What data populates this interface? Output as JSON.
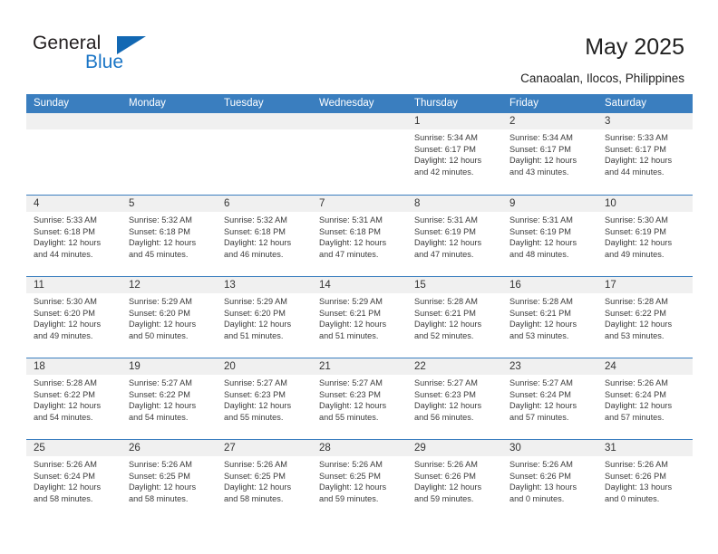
{
  "logo": {
    "word_top": "General",
    "word_bottom": "Blue",
    "triangle_color": "#1268b3",
    "blue_color": "#1a75c6"
  },
  "header": {
    "title": "May 2025",
    "subtitle": "Canaoalan, Ilocos, Philippines"
  },
  "calendar": {
    "header_color": "#3a7ebf",
    "weekdays": [
      "Sunday",
      "Monday",
      "Tuesday",
      "Wednesday",
      "Thursday",
      "Friday",
      "Saturday"
    ],
    "weeks": [
      [
        {
          "day": "",
          "empty": true
        },
        {
          "day": "",
          "empty": true
        },
        {
          "day": "",
          "empty": true
        },
        {
          "day": "",
          "empty": true
        },
        {
          "day": "1",
          "sunrise": "Sunrise: 5:34 AM",
          "sunset": "Sunset: 6:17 PM",
          "daylight": "Daylight: 12 hours and 42 minutes."
        },
        {
          "day": "2",
          "sunrise": "Sunrise: 5:34 AM",
          "sunset": "Sunset: 6:17 PM",
          "daylight": "Daylight: 12 hours and 43 minutes."
        },
        {
          "day": "3",
          "sunrise": "Sunrise: 5:33 AM",
          "sunset": "Sunset: 6:17 PM",
          "daylight": "Daylight: 12 hours and 44 minutes."
        }
      ],
      [
        {
          "day": "4",
          "sunrise": "Sunrise: 5:33 AM",
          "sunset": "Sunset: 6:18 PM",
          "daylight": "Daylight: 12 hours and 44 minutes."
        },
        {
          "day": "5",
          "sunrise": "Sunrise: 5:32 AM",
          "sunset": "Sunset: 6:18 PM",
          "daylight": "Daylight: 12 hours and 45 minutes."
        },
        {
          "day": "6",
          "sunrise": "Sunrise: 5:32 AM",
          "sunset": "Sunset: 6:18 PM",
          "daylight": "Daylight: 12 hours and 46 minutes."
        },
        {
          "day": "7",
          "sunrise": "Sunrise: 5:31 AM",
          "sunset": "Sunset: 6:18 PM",
          "daylight": "Daylight: 12 hours and 47 minutes."
        },
        {
          "day": "8",
          "sunrise": "Sunrise: 5:31 AM",
          "sunset": "Sunset: 6:19 PM",
          "daylight": "Daylight: 12 hours and 47 minutes."
        },
        {
          "day": "9",
          "sunrise": "Sunrise: 5:31 AM",
          "sunset": "Sunset: 6:19 PM",
          "daylight": "Daylight: 12 hours and 48 minutes."
        },
        {
          "day": "10",
          "sunrise": "Sunrise: 5:30 AM",
          "sunset": "Sunset: 6:19 PM",
          "daylight": "Daylight: 12 hours and 49 minutes."
        }
      ],
      [
        {
          "day": "11",
          "sunrise": "Sunrise: 5:30 AM",
          "sunset": "Sunset: 6:20 PM",
          "daylight": "Daylight: 12 hours and 49 minutes."
        },
        {
          "day": "12",
          "sunrise": "Sunrise: 5:29 AM",
          "sunset": "Sunset: 6:20 PM",
          "daylight": "Daylight: 12 hours and 50 minutes."
        },
        {
          "day": "13",
          "sunrise": "Sunrise: 5:29 AM",
          "sunset": "Sunset: 6:20 PM",
          "daylight": "Daylight: 12 hours and 51 minutes."
        },
        {
          "day": "14",
          "sunrise": "Sunrise: 5:29 AM",
          "sunset": "Sunset: 6:21 PM",
          "daylight": "Daylight: 12 hours and 51 minutes."
        },
        {
          "day": "15",
          "sunrise": "Sunrise: 5:28 AM",
          "sunset": "Sunset: 6:21 PM",
          "daylight": "Daylight: 12 hours and 52 minutes."
        },
        {
          "day": "16",
          "sunrise": "Sunrise: 5:28 AM",
          "sunset": "Sunset: 6:21 PM",
          "daylight": "Daylight: 12 hours and 53 minutes."
        },
        {
          "day": "17",
          "sunrise": "Sunrise: 5:28 AM",
          "sunset": "Sunset: 6:22 PM",
          "daylight": "Daylight: 12 hours and 53 minutes."
        }
      ],
      [
        {
          "day": "18",
          "sunrise": "Sunrise: 5:28 AM",
          "sunset": "Sunset: 6:22 PM",
          "daylight": "Daylight: 12 hours and 54 minutes."
        },
        {
          "day": "19",
          "sunrise": "Sunrise: 5:27 AM",
          "sunset": "Sunset: 6:22 PM",
          "daylight": "Daylight: 12 hours and 54 minutes."
        },
        {
          "day": "20",
          "sunrise": "Sunrise: 5:27 AM",
          "sunset": "Sunset: 6:23 PM",
          "daylight": "Daylight: 12 hours and 55 minutes."
        },
        {
          "day": "21",
          "sunrise": "Sunrise: 5:27 AM",
          "sunset": "Sunset: 6:23 PM",
          "daylight": "Daylight: 12 hours and 55 minutes."
        },
        {
          "day": "22",
          "sunrise": "Sunrise: 5:27 AM",
          "sunset": "Sunset: 6:23 PM",
          "daylight": "Daylight: 12 hours and 56 minutes."
        },
        {
          "day": "23",
          "sunrise": "Sunrise: 5:27 AM",
          "sunset": "Sunset: 6:24 PM",
          "daylight": "Daylight: 12 hours and 57 minutes."
        },
        {
          "day": "24",
          "sunrise": "Sunrise: 5:26 AM",
          "sunset": "Sunset: 6:24 PM",
          "daylight": "Daylight: 12 hours and 57 minutes."
        }
      ],
      [
        {
          "day": "25",
          "sunrise": "Sunrise: 5:26 AM",
          "sunset": "Sunset: 6:24 PM",
          "daylight": "Daylight: 12 hours and 58 minutes."
        },
        {
          "day": "26",
          "sunrise": "Sunrise: 5:26 AM",
          "sunset": "Sunset: 6:25 PM",
          "daylight": "Daylight: 12 hours and 58 minutes."
        },
        {
          "day": "27",
          "sunrise": "Sunrise: 5:26 AM",
          "sunset": "Sunset: 6:25 PM",
          "daylight": "Daylight: 12 hours and 58 minutes."
        },
        {
          "day": "28",
          "sunrise": "Sunrise: 5:26 AM",
          "sunset": "Sunset: 6:25 PM",
          "daylight": "Daylight: 12 hours and 59 minutes."
        },
        {
          "day": "29",
          "sunrise": "Sunrise: 5:26 AM",
          "sunset": "Sunset: 6:26 PM",
          "daylight": "Daylight: 12 hours and 59 minutes."
        },
        {
          "day": "30",
          "sunrise": "Sunrise: 5:26 AM",
          "sunset": "Sunset: 6:26 PM",
          "daylight": "Daylight: 13 hours and 0 minutes."
        },
        {
          "day": "31",
          "sunrise": "Sunrise: 5:26 AM",
          "sunset": "Sunset: 6:26 PM",
          "daylight": "Daylight: 13 hours and 0 minutes."
        }
      ]
    ]
  }
}
